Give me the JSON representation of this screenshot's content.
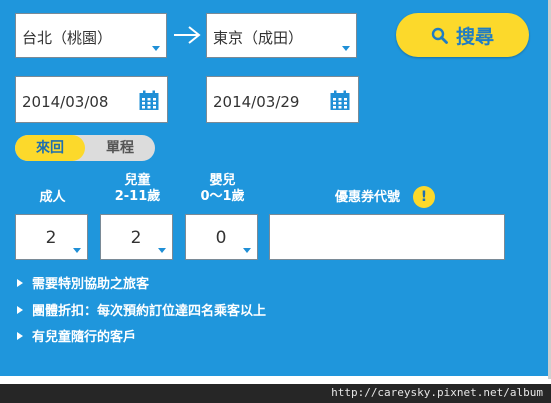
{
  "route": {
    "origin": "台北（桃園）",
    "destination": "東京（成田）"
  },
  "search_button": {
    "label": "搜尋"
  },
  "dates": {
    "depart": "2014/03/08",
    "return": "2014/03/29"
  },
  "trip_type": {
    "round_trip": "來回",
    "one_way": "單程",
    "selected": "來回"
  },
  "passengers": {
    "adult": {
      "label": "成人",
      "value": "2"
    },
    "child": {
      "label_line1": "兒童",
      "label_line2": "2-11歲",
      "value": "2"
    },
    "infant": {
      "label_line1": "嬰兒",
      "label_line2": "0～1歲",
      "value": "0"
    }
  },
  "coupon": {
    "label": "優惠券代號",
    "value": ""
  },
  "links": [
    "需要特別協助之旅客",
    "團體折扣：每次預約訂位達四名乘客以上",
    "有兒童隨行的客戶"
  ],
  "footer": {
    "url": "http://careysky.pixnet.net/album"
  },
  "colors": {
    "panel": "#1f96dc",
    "accent": "#fcd92b"
  }
}
